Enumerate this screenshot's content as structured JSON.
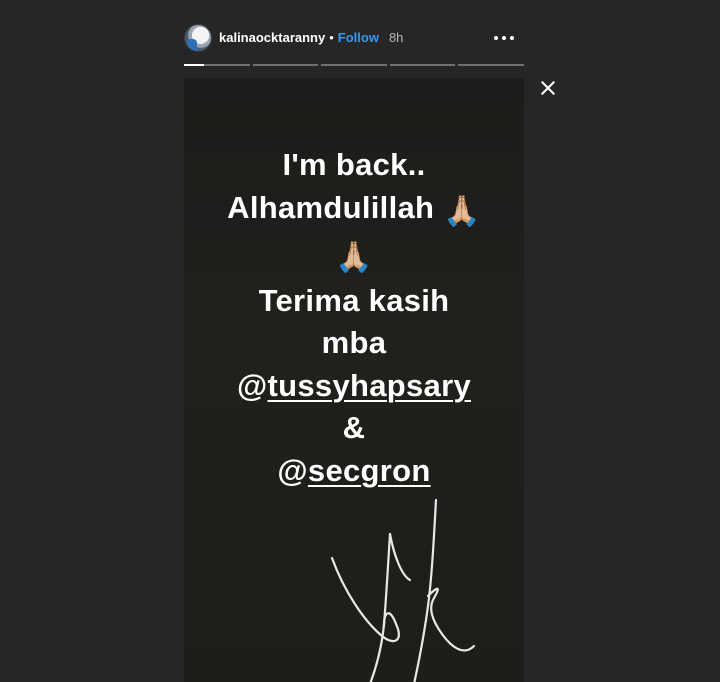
{
  "header": {
    "username": "kalinaocktaranny",
    "separator": "•",
    "follow_label": "Follow",
    "time": "8h"
  },
  "progress": {
    "segments": [
      0.3,
      0,
      0,
      0,
      0
    ]
  },
  "story": {
    "line1": "I'm back..",
    "line2": "Alhamdulillah",
    "line2_emoji": "🙏🏼",
    "line3_emoji": "🙏🏼",
    "line4": "Terima kasih",
    "line5": "mba",
    "mention1_at": "@",
    "mention1_handle": "tussyhapsary",
    "line7": "&",
    "mention2_at": "@",
    "mention2_handle": "secgron"
  },
  "icons": {
    "more": "more-options-icon",
    "close": "close-icon",
    "signature": "signature-drawing"
  },
  "colors": {
    "background": "#262626",
    "follow": "#3897f0",
    "text": "#ffffff"
  }
}
